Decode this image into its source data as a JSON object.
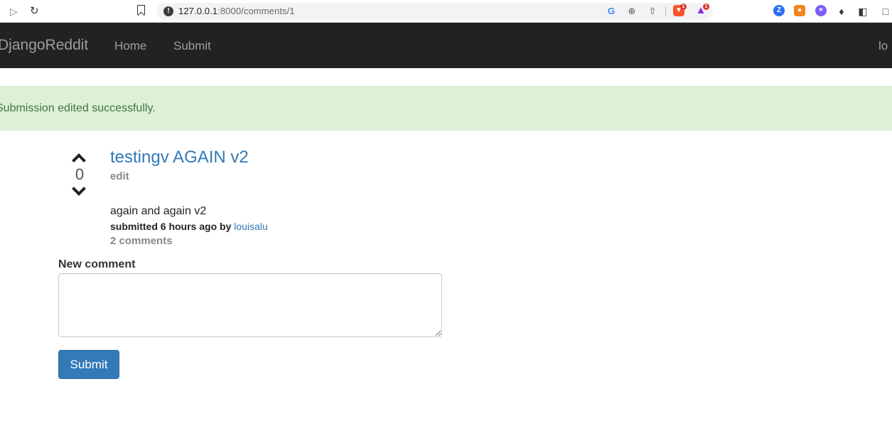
{
  "browser": {
    "url_host": "127.0.0.1",
    "url_rest": ":8000/comments/1",
    "extension_badges": [
      "1",
      "1"
    ]
  },
  "navbar": {
    "brand": "DjangoReddit",
    "links": [
      "Home",
      "Submit"
    ],
    "right_text": "lo"
  },
  "alert": {
    "message": "Submission edited successfully."
  },
  "post": {
    "score": "0",
    "title": "testingv AGAIN v2",
    "edit_label": "edit",
    "body": "again and again v2",
    "meta_prefix": "submitted 6 hours ago by ",
    "author": "louisalu",
    "comments_label": "2 comments"
  },
  "comment_form": {
    "label": "New comment",
    "value": "",
    "submit_label": "Submit"
  },
  "colors": {
    "navbar_bg": "#222222",
    "alert_bg": "#dff0d8",
    "alert_text": "#3c763d",
    "link": "#337ab7",
    "button": "#337ab7"
  }
}
